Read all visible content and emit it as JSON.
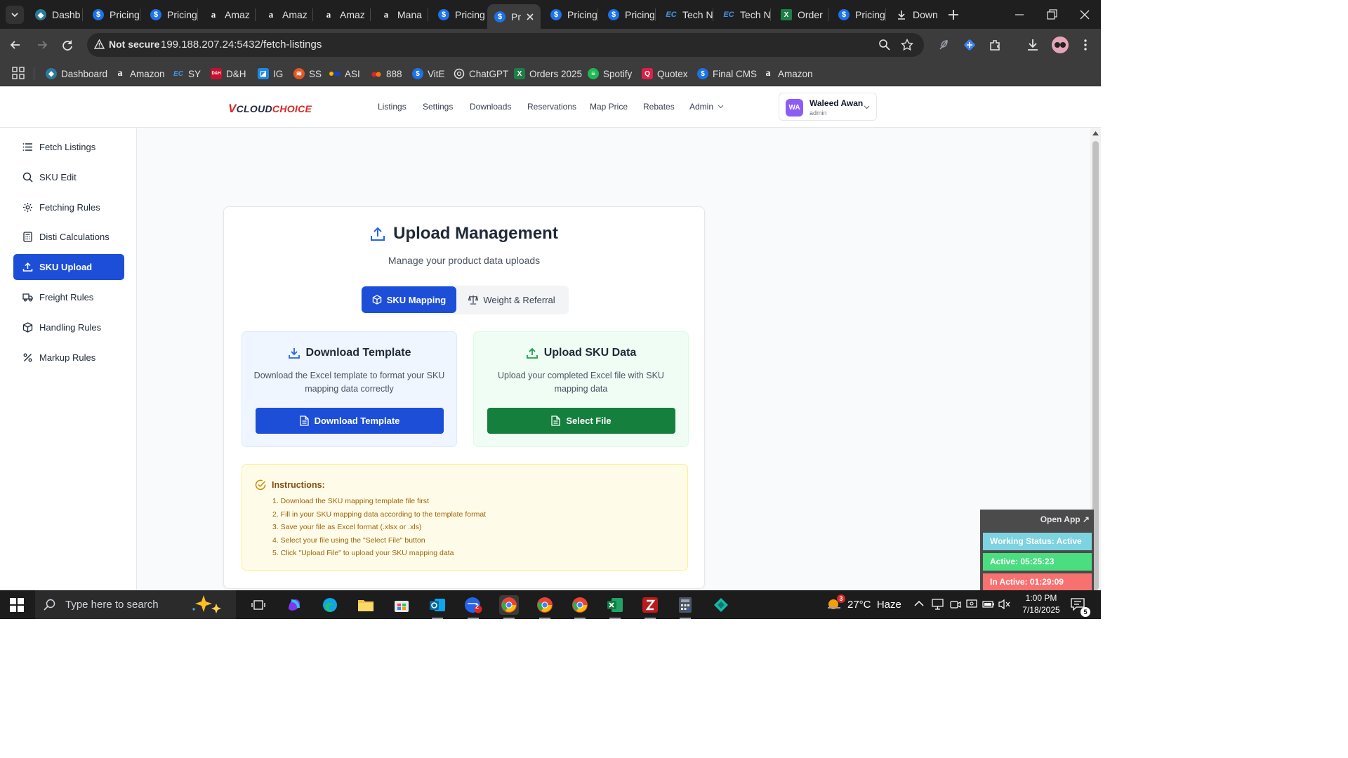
{
  "browser": {
    "tabs": [
      {
        "title": "Dashb",
        "icon": "dashboard-icon"
      },
      {
        "title": "Pricing",
        "icon": "s-icon"
      },
      {
        "title": "Pricing",
        "icon": "s-icon"
      },
      {
        "title": "Amaz",
        "icon": "amazon-icon"
      },
      {
        "title": "Amaz",
        "icon": "amazon-icon"
      },
      {
        "title": "Amaz",
        "icon": "amazon-icon"
      },
      {
        "title": "Mana",
        "icon": "amazon-icon"
      },
      {
        "title": "Pricing",
        "icon": "s-icon"
      },
      {
        "title": "Pr",
        "icon": "s-icon"
      },
      {
        "title": "Pricing",
        "icon": "s-icon"
      },
      {
        "title": "Pricing",
        "icon": "s-icon"
      },
      {
        "title": "Tech N",
        "icon": "ec-icon"
      },
      {
        "title": "Tech N",
        "icon": "ec-icon"
      },
      {
        "title": "Order",
        "icon": "excel-icon"
      },
      {
        "title": "Pricing",
        "icon": "s-icon"
      },
      {
        "title": "Down",
        "icon": "download-icon"
      }
    ],
    "security_label": "Not secure",
    "url": "199.188.207.24:5432/fetch-listings",
    "bookmarks": [
      "Dashboard",
      "Amazon",
      "SY",
      "D&H",
      "IG",
      "SS",
      "ASI",
      "888",
      "VitE",
      "ChatGPT",
      "Orders 2025",
      "Spotify",
      "Quotex",
      "Final CMS",
      "Amazon"
    ],
    "bookmark_badges": {
      "sy": "EC",
      "dh": "D&H",
      "vite": "$"
    }
  },
  "app": {
    "logo_v": "V",
    "logo_cloud": "CLOUD",
    "logo_choice": "CHOICE",
    "nav": [
      "Listings",
      "Settings",
      "Downloads",
      "Reservations",
      "Map Price",
      "Rebates",
      "Admin"
    ],
    "user": {
      "initials": "WA",
      "name": "Waleed Awan",
      "role": "admin"
    },
    "sidebar": [
      "Fetch Listings",
      "SKU Edit",
      "Fetching Rules",
      "Disti Calculations",
      "SKU Upload",
      "Freight Rules",
      "Handling Rules",
      "Markup Rules"
    ],
    "active_sidebar": "SKU Upload"
  },
  "upload": {
    "title": "Upload Management",
    "subtitle": "Manage your product data uploads",
    "tabs": [
      "SKU Mapping",
      "Weight & Referral"
    ],
    "active_tab": "SKU Mapping",
    "download": {
      "title": "Download Template",
      "description": "Download the Excel template to format your SKU mapping data correctly",
      "button": "Download Template"
    },
    "upload": {
      "title": "Upload SKU Data",
      "description": "Upload your completed Excel file with SKU mapping data",
      "button": "Select File"
    },
    "instructions": {
      "title": "Instructions:",
      "steps": [
        "1. Download the SKU mapping template file first",
        "2. Fill in your SKU mapping data according to the template format",
        "3. Save your file as Excel format (.xlsx or .xls)",
        "4. Select your file using the \"Select File\" button",
        "5. Click \"Upload File\" to upload your SKU mapping data"
      ]
    }
  },
  "widget": {
    "open_app": "Open App ↗",
    "status": "Working Status: Active",
    "active": "Active: 05:25:23",
    "inactive": "In Active: 01:29:09"
  },
  "taskbar": {
    "search_placeholder": "Type here to search",
    "weather": "27°C  Haze",
    "weather_badge": "3",
    "time": "1:00 PM",
    "date": "7/18/2025",
    "notifications": "5",
    "outlook_badge": "2"
  },
  "colors": {
    "primary": "#1d4ed8",
    "success": "#15803d",
    "avatar": "#8b5cf6",
    "warning_bg": "#fefce8"
  }
}
